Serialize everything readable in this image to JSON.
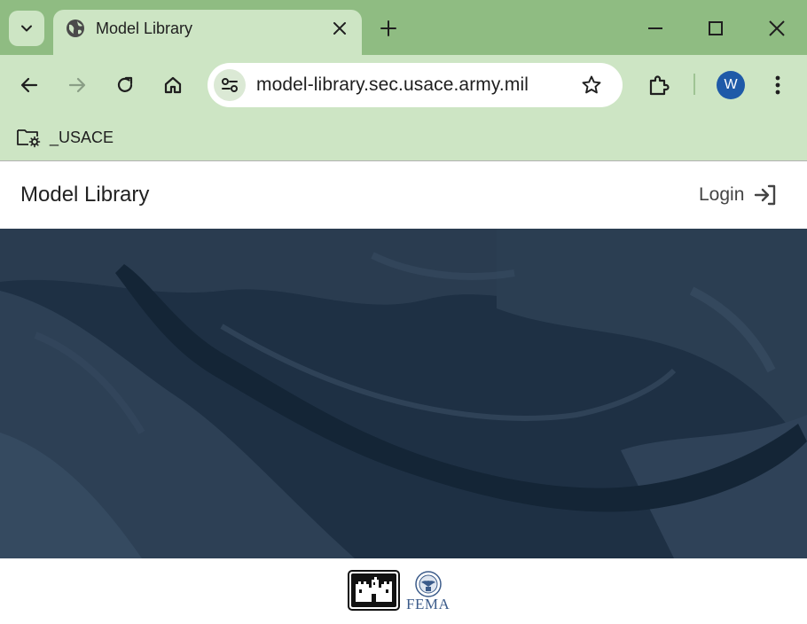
{
  "browser": {
    "tab": {
      "title": "Model Library"
    },
    "address_bar": {
      "url": "model-library.sec.usace.army.mil"
    },
    "bookmarks": [
      {
        "label": "_USACE"
      }
    ],
    "profile": {
      "initial": "W",
      "color": "#1f5aa8"
    },
    "colors": {
      "frame": "#8fbc82",
      "toolbar": "#cde5c4"
    }
  },
  "header": {
    "title": "Model Library",
    "login_label": "Login"
  },
  "hero": {
    "color": "#1b2d40"
  },
  "footer": {
    "logos": [
      {
        "name": "usace-castle-logo"
      },
      {
        "name": "fema-logo",
        "text": "FEMA"
      }
    ]
  },
  "icons": {
    "tab_search": "chevron-down-icon",
    "favicon": "globe-icon",
    "tab_close": "close-icon",
    "new_tab": "plus-icon",
    "back": "arrow-left-icon",
    "forward": "arrow-right-icon",
    "reload": "reload-icon",
    "home": "home-icon",
    "site_info": "tune-icon",
    "bookmark": "star-icon",
    "extensions": "puzzle-icon",
    "menu": "kebab-menu-icon",
    "bookmark_folder": "folder-gear-icon",
    "login": "login-icon"
  }
}
